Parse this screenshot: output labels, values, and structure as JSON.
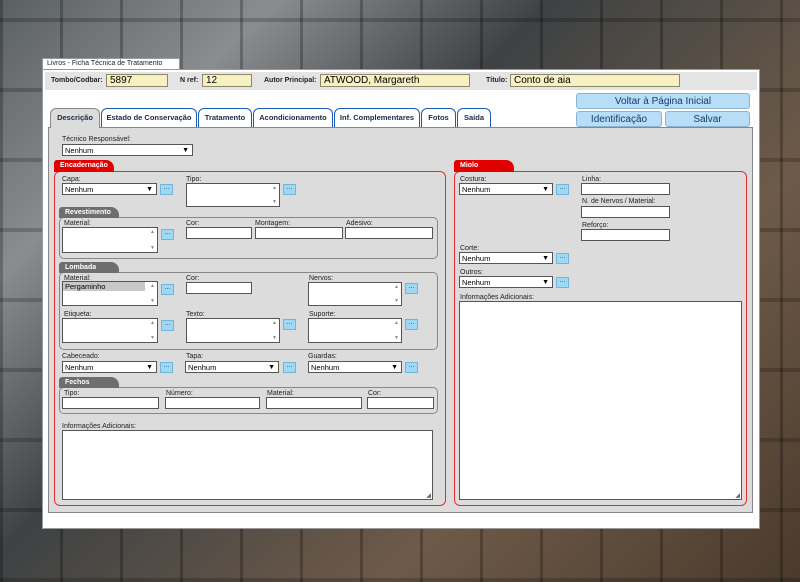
{
  "window": {
    "title": "Livros - Ficha Técnica de Tratamento"
  },
  "header": {
    "tombo_label": "Tombo/Codbar:",
    "tombo_value": "5897",
    "nref_label": "N ref:",
    "nref_value": "12",
    "autor_label": "Autor Principal:",
    "autor_value": "ATWOOD, Margareth",
    "titulo_label": "Título:",
    "titulo_value": "Conto de aia"
  },
  "actions": {
    "voltar": "Voltar à Página Inicial",
    "identificacao": "Identificação",
    "salvar": "Salvar"
  },
  "tabs": [
    "Descrição",
    "Estado de Conservação",
    "Tratamento",
    "Acondicionamento",
    "Inf. Complementares",
    "Fotos",
    "Saída"
  ],
  "tecnico": {
    "label": "Técnico Responsável:",
    "value": "Nenhum"
  },
  "encadernacao": {
    "title": "Encadernação",
    "capa_label": "Capa:",
    "capa_value": "Nenhum",
    "tipo_label": "Tipo:",
    "revestimento": {
      "title": "Revestimento",
      "material": "Material:",
      "cor": "Cor:",
      "montagem": "Montagem:",
      "adesivo": "Adesivo:"
    },
    "lombada": {
      "title": "Lombada",
      "material": "Material:",
      "material_value": "Pergaminho",
      "cor": "Cor:",
      "nervos": "Nervos:",
      "etiqueta": "Etiqueta:",
      "texto": "Texto:",
      "suporte": "Suporte:"
    },
    "cabeceado_label": "Cabeceado:",
    "cabeceado_value": "Nenhum",
    "tapa_label": "Tapa:",
    "tapa_value": "Nenhum",
    "guardas_label": "Guardas:",
    "guardas_value": "Nenhum",
    "fechos": {
      "title": "Fechos",
      "tipo": "Tipo:",
      "numero": "Número:",
      "material": "Material:",
      "cor": "Cor:"
    },
    "info_label": "Informações Adicionais:"
  },
  "miolo": {
    "title": "Miolo",
    "costura_label": "Costura:",
    "costura_value": "Nenhum",
    "linha_label": "Linha:",
    "nervos_label": "N. de Nervos / Material:",
    "reforco_label": "Reforço:",
    "corte_label": "Corte:",
    "corte_value": "Nenhum",
    "outros_label": "Outros:",
    "outros_value": "Nenhum",
    "info_label": "Informações Adicionais:"
  },
  "common": {
    "dots": "...",
    "arrow": "▼",
    "up": "▲",
    "down": "▼",
    "grip": "◢"
  }
}
